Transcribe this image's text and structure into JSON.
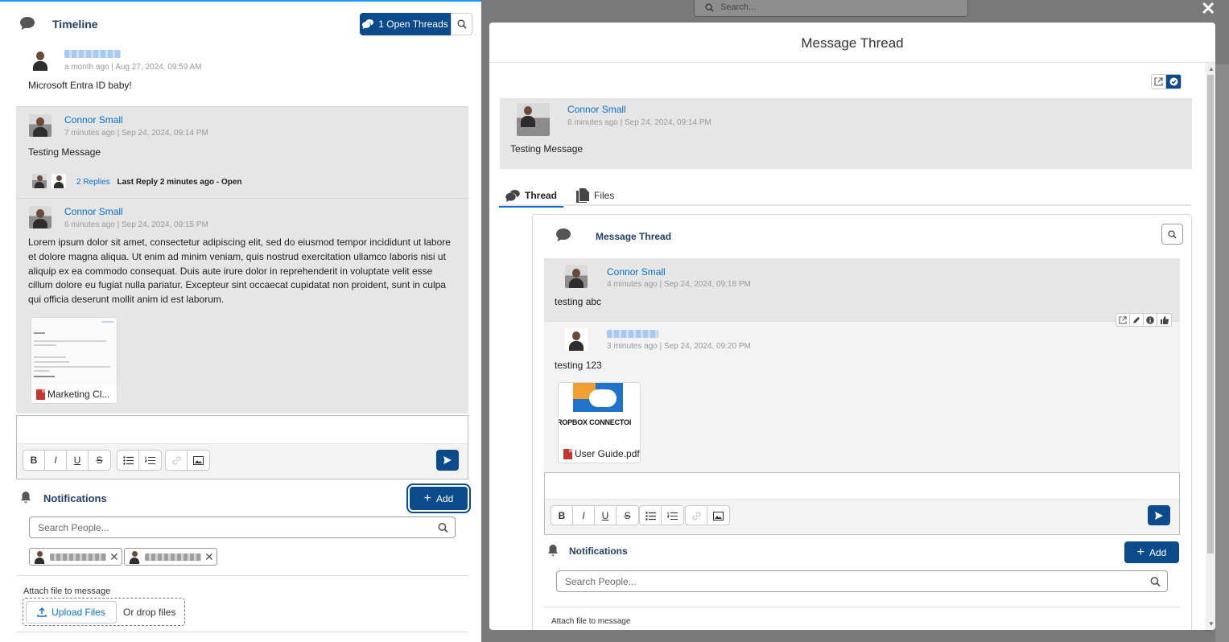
{
  "timeline": {
    "title": "Timeline",
    "open_threads_label": "1 Open Threads",
    "posts": [
      {
        "meta": "a month ago | Aug 27, 2024, 09:59 AM",
        "body": "Microsoft Entra ID baby!"
      },
      {
        "author": "Connor Small",
        "meta": "7 minutes ago | Sep 24, 2024, 09:14 PM",
        "body": "Testing Message",
        "replies_link": "2 Replies",
        "last_reply": "Last Reply 2 minutes ago - Open"
      },
      {
        "author": "Connor Small",
        "meta": "6 minutes ago | Sep 24, 2024, 09:15 PM",
        "body": "Lorem ipsum dolor sit amet, consectetur adipiscing elit, sed do eiusmod tempor incididunt ut labore et dolore magna aliqua. Ut enim ad minim veniam, quis nostrud exercitation ullamco laboris nisi ut aliquip ex ea commodo consequat. Duis aute irure dolor in reprehenderit in voluptate velit esse cillum dolore eu fugiat nulla pariatur. Excepteur sint occaecat cupidatat non proident, sunt in culpa qui officia deserunt mollit anim id est laborum.",
        "attachment": "Marketing Cl..."
      }
    ],
    "editor_toolbar": [
      "B",
      "I",
      "U",
      "S"
    ],
    "notifications_title": "Notifications",
    "add_label": "Add",
    "search_placeholder": "Search People...",
    "attach_label": "Attach file to message",
    "upload_label": "Upload Files",
    "drop_label": "Or drop files"
  },
  "background": {
    "search_placeholder": "Search..."
  },
  "modal": {
    "title": "Message Thread",
    "root": {
      "author": "Connor Small",
      "meta": "8 minutes ago | Sep 24, 2024, 09:14 PM",
      "body": "Testing Message"
    },
    "tabs": [
      {
        "label": "Thread",
        "active": true
      },
      {
        "label": "Files",
        "active": false
      }
    ],
    "thread": {
      "title": "Message Thread",
      "replies": [
        {
          "author": "Connor Small",
          "meta": "4 minutes ago | Sep 24, 2024, 09:18 PM",
          "body": "testing abc"
        },
        {
          "meta": "3 minutes ago | Sep 24, 2024, 09:20 PM",
          "body": "testing 123",
          "attachment": "User Guide.pdf",
          "attachment_preview_text": "ROPBOX CONNECTOI"
        }
      ],
      "notifications_title": "Notifications",
      "add_label": "Add",
      "search_placeholder": "Search People...",
      "attach_label": "Attach file to message"
    }
  },
  "colors": {
    "brand": "#0b4a8b",
    "link": "#0b6fcc",
    "heading": "#23406b",
    "muted_bg": "#e6e6e6"
  }
}
